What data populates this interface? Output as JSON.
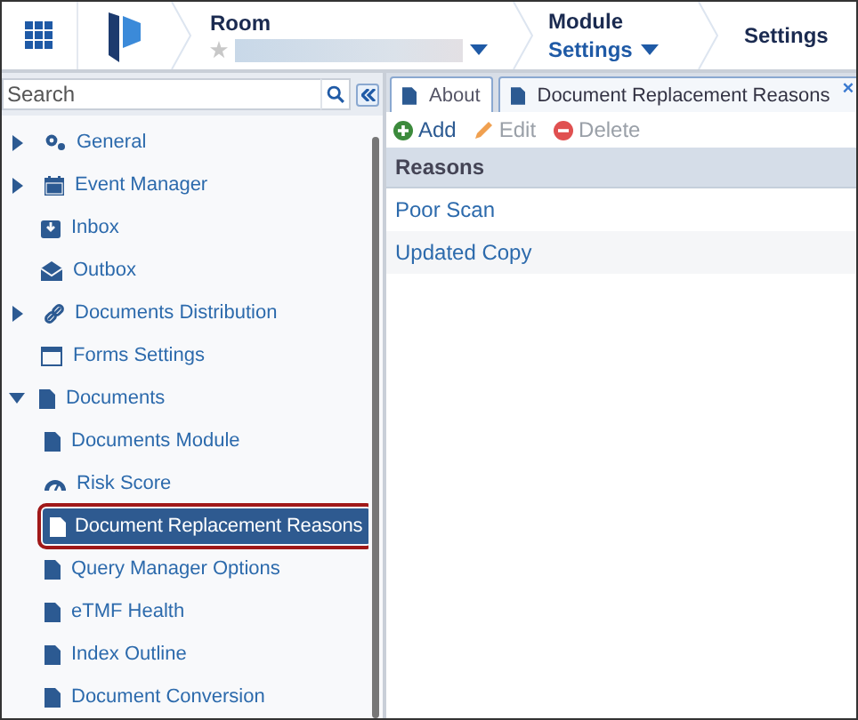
{
  "header": {
    "room_label": "Room",
    "room_favorite": false,
    "module_label": "Module",
    "module_value": "Settings",
    "page_title": "Settings"
  },
  "sidebar": {
    "search": {
      "placeholder": "Search"
    },
    "items": [
      {
        "label": "General",
        "expanded": false,
        "selected": false
      },
      {
        "label": "Event Manager",
        "expanded": false,
        "selected": false
      },
      {
        "label": "Inbox",
        "selected": false
      },
      {
        "label": "Outbox",
        "selected": false
      },
      {
        "label": "Documents Distribution",
        "expanded": false,
        "selected": false
      },
      {
        "label": "Forms Settings",
        "selected": false
      },
      {
        "label": "Documents",
        "expanded": true,
        "selected": false,
        "children": [
          {
            "label": "Documents Module",
            "selected": false
          },
          {
            "label": "Risk Score",
            "selected": false
          },
          {
            "label": "Document Replacement Reasons",
            "selected": true
          },
          {
            "label": "Query Manager Options",
            "selected": false
          },
          {
            "label": "eTMF Health",
            "selected": false
          },
          {
            "label": "Index Outline",
            "selected": false
          },
          {
            "label": "Document Conversion",
            "selected": false
          }
        ]
      }
    ]
  },
  "tabs": [
    {
      "label": "About",
      "selected": false
    },
    {
      "label": "Document Replacement Reasons",
      "selected": true,
      "close": "×"
    }
  ],
  "toolbar": [
    {
      "label": "Add",
      "disabled": false
    },
    {
      "label": "Edit",
      "disabled": true
    },
    {
      "label": "Delete",
      "disabled": true
    }
  ],
  "table": {
    "columns": [
      "Reasons"
    ],
    "rows": [
      "Poor Scan",
      "Updated Copy"
    ]
  }
}
